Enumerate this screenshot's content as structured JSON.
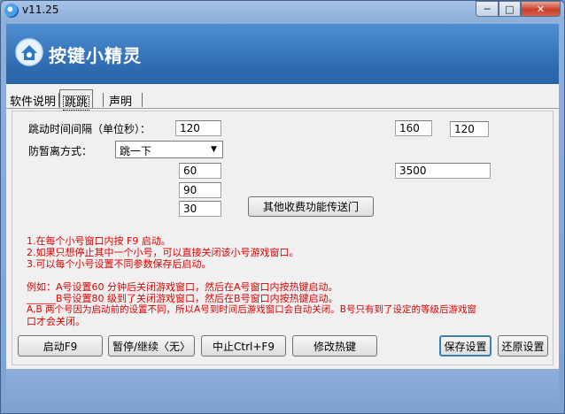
{
  "window": {
    "title": "v11.25"
  },
  "banner": {
    "app_name": "按键小精灵"
  },
  "tabs": [
    {
      "label": "软件说明"
    },
    {
      "label": "跳跳"
    },
    {
      "label": "声明"
    }
  ],
  "form": {
    "interval_label": "跳动时间间隔（单位秒）：",
    "interval_value": "120",
    "right_top_1": "160",
    "right_top_2": "120",
    "mode_label": "防暂离方式：",
    "mode_value": "跳一下",
    "val_60": "60",
    "val_3500": "3500",
    "val_90": "90",
    "val_30": "30",
    "other_button": "其他收费功能传送门"
  },
  "notes": {
    "line1": "1.在每个小号窗口内按 F9 启动。",
    "line2": "2.如果只想停止其中一个小号，可以直接关闭该小号游戏窗口。",
    "line3": "3.可以每个小号设置不同参数保存后启动。",
    "ex1": "例如：A号设置60 分钟后关闭游戏窗口，然后在A号窗口内按热键启动。",
    "ex2": "______B号设置80 级到了关闭游戏窗口，然后在B号窗口内按热键启动。",
    "ex3": "A,B 两个号因为启动前的设置不同，所以A号到时间后游戏窗口会自动关闭。B号只有到了设定的等级后游戏窗",
    "ex4": "口才会关闭。"
  },
  "buttons": {
    "start": "启动F9",
    "pause": "暂停/继续〈无〉",
    "stop": "中止Ctrl+F9",
    "hotkey": "修改热键",
    "save": "保存设置",
    "restore": "还原设置"
  },
  "window_controls": {
    "minimize": "─",
    "maximize": "□",
    "close": "✕"
  },
  "colors": {
    "note_red": "#e00000",
    "banner_blue": "#2f6cb4"
  }
}
